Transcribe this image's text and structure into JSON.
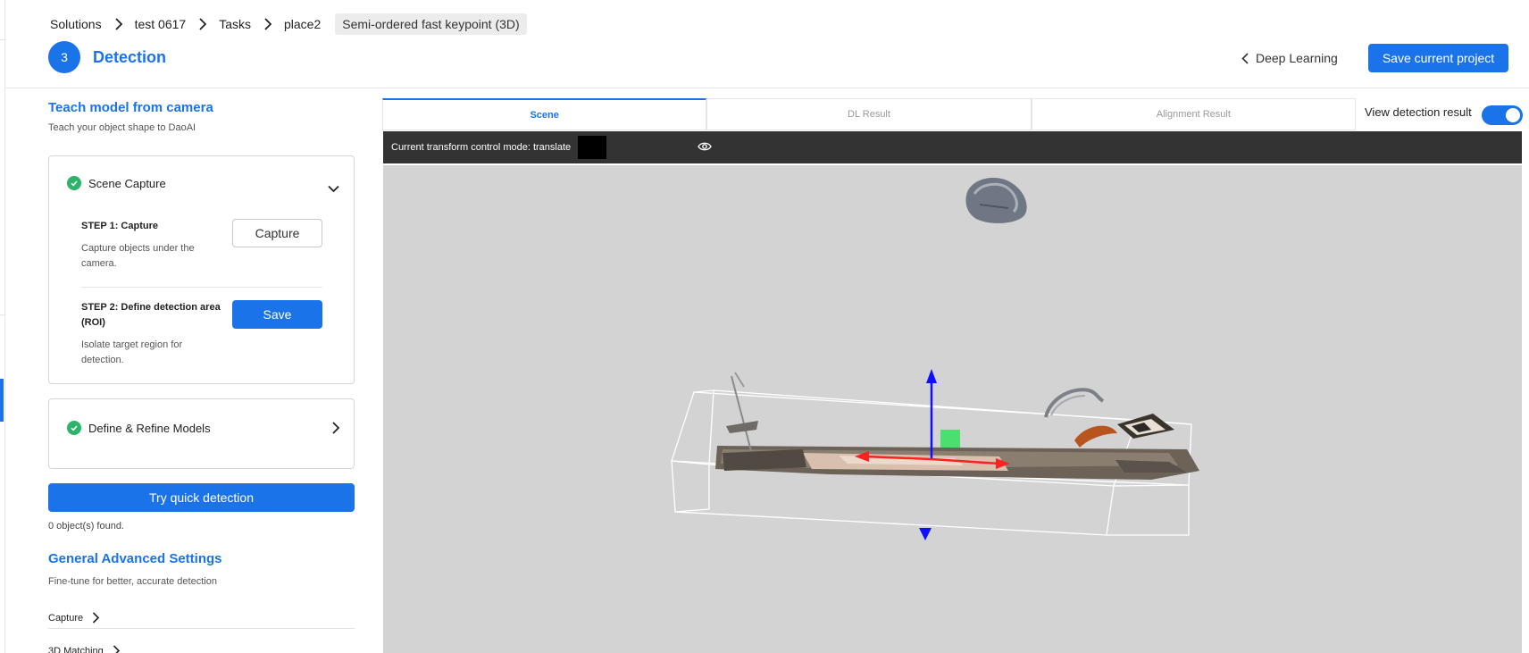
{
  "breadcrumb": {
    "items": [
      "Solutions",
      "test 0617",
      "Tasks",
      "place2"
    ],
    "current": "Semi-ordered fast keypoint (3D)"
  },
  "header": {
    "step_number": "3",
    "title": "Detection",
    "back_link": "Deep Learning",
    "save_button": "Save current project"
  },
  "sidebar": {
    "teach_title": "Teach model from camera",
    "teach_subtitle": "Teach your object shape to DaoAI",
    "scene_capture": {
      "label": "Scene Capture",
      "status_icon": "check-circle-icon",
      "step1_title": "STEP 1: Capture",
      "step1_desc": "Capture objects under the camera.",
      "capture_button": "Capture",
      "step2_title": "STEP 2: Define detection area (ROI)",
      "step2_desc": "Isolate target region for detection.",
      "save_button": "Save"
    },
    "define_models": {
      "label": "Define & Refine Models",
      "status_icon": "check-circle-icon"
    },
    "quick_detection_button": "Try quick detection",
    "objects_found": "0 object(s) found.",
    "advanced_title": "General Advanced Settings",
    "advanced_subtitle": "Fine-tune for better, accurate detection",
    "advanced_items": [
      "Capture",
      "3D Matching"
    ]
  },
  "viewer": {
    "tabs": [
      "Scene",
      "DL Result",
      "Alignment Result"
    ],
    "active_tab": "Scene",
    "view_detection_label": "View detection result",
    "view_detection_enabled": true,
    "toolbar_text": "Current transform control mode: translate",
    "toolbar_swatch_color": "#000000"
  },
  "colors": {
    "accent": "#1a73e8",
    "success": "#2db36a",
    "toolbar_bg": "#333333",
    "viewport_bg": "#d3d3d3"
  }
}
